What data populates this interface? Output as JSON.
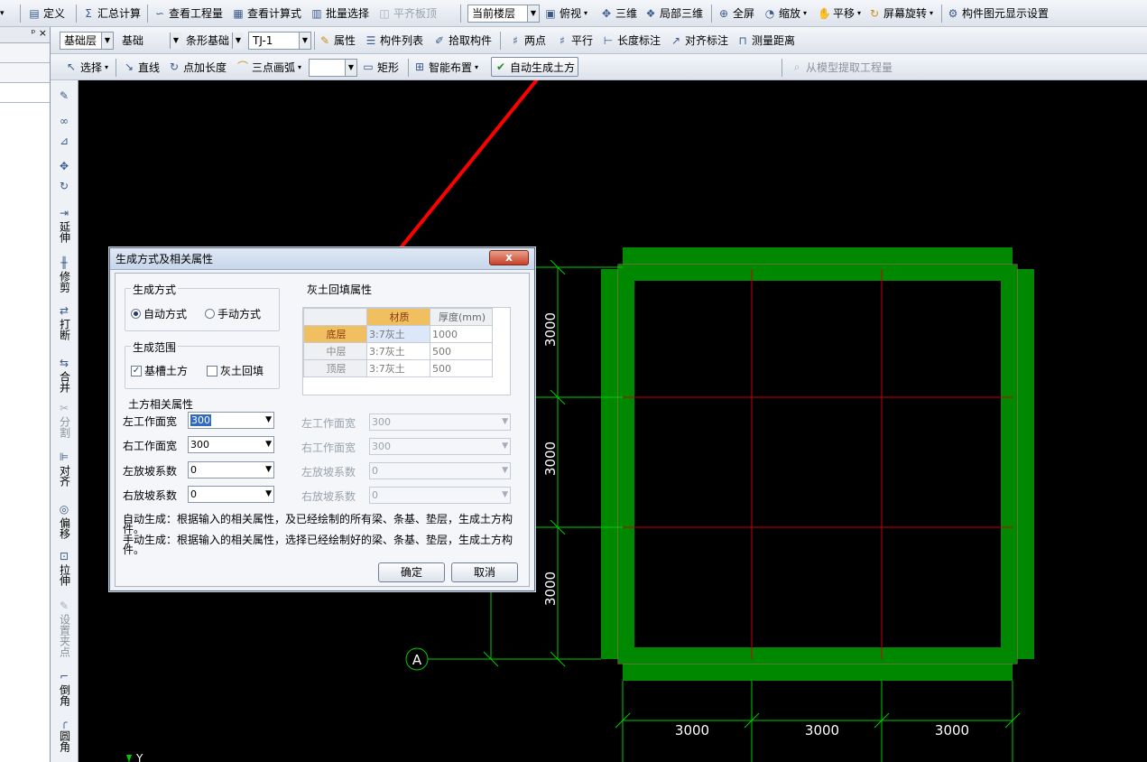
{
  "toolbar1": {
    "items": [
      "定义",
      "汇总计算",
      "查看工程量",
      "查看计算式",
      "批量选择",
      "平齐板顶"
    ],
    "floor": "当前楼层",
    "view": [
      "俯视",
      "三维",
      "局部三维",
      "全屏",
      "缩放",
      "平移",
      "屏幕旋转",
      "构件图元显示设置"
    ]
  },
  "toolbar2": {
    "layer": "基础层",
    "category": "基础",
    "type": "条形基础",
    "component": "TJ-1",
    "items": [
      "属性",
      "构件列表",
      "拾取构件",
      "两点",
      "平行",
      "长度标注",
      "对齐标注",
      "测量距离"
    ]
  },
  "toolbar3": {
    "items": [
      "选择",
      "直线",
      "点加长度",
      "三点画弧",
      "矩形",
      "智能布置",
      "自动生成土方",
      "从模型提取工程量"
    ]
  },
  "panel": {
    "pin": "ᵖ",
    "close": "×"
  },
  "vtools": [
    "延伸",
    "修剪",
    "打断",
    "合并",
    "分割",
    "对齐",
    "偏移",
    "拉伸",
    "设置夹点",
    "倒角",
    "圆角"
  ],
  "dialog": {
    "title": "生成方式及相关属性",
    "close": "x",
    "mode_group": "生成方式",
    "mode_auto": "自动方式",
    "mode_manual": "手动方式",
    "range_group": "生成范围",
    "range_pit": "基槽土方",
    "range_fill": "灰土回填",
    "earth_group": "土方相关属性",
    "fields": [
      {
        "label": "左工作面宽",
        "value": "300"
      },
      {
        "label": "右工作面宽",
        "value": "300"
      },
      {
        "label": "左放坡系数",
        "value": "0"
      },
      {
        "label": "右放坡系数",
        "value": "0"
      }
    ],
    "fill_group": "灰土回填属性",
    "fill_table": {
      "headers": [
        "材质",
        "厚度(mm)"
      ],
      "rows": [
        {
          "name": "底层",
          "material": "3:7灰土",
          "thickness": "1000"
        },
        {
          "name": "中层",
          "material": "3:7灰土",
          "thickness": "500"
        },
        {
          "name": "顶层",
          "material": "3:7灰土",
          "thickness": "500"
        }
      ]
    },
    "fill_fields": [
      {
        "label": "左工作面宽",
        "value": "300"
      },
      {
        "label": "右工作面宽",
        "value": "300"
      },
      {
        "label": "左放坡系数",
        "value": "0"
      },
      {
        "label": "右放坡系数",
        "value": "0"
      }
    ],
    "note1a": "自动生成：根据输入的相关属性，及已经绘制的所有梁、条基、垫层，生成土方构",
    "note1b": "件。",
    "note2a": "手动生成：根据输入的相关属性，选择已经绘制好的梁、条基、垫层，生成土方构",
    "note2b": "件。",
    "ok": "确定",
    "cancel": "取消"
  },
  "drawing": {
    "dims_bottom": [
      "3000",
      "3000",
      "3000"
    ],
    "dims_left": [
      "3000",
      "3000",
      "3000"
    ],
    "axis_label": "A",
    "ucs_label": "Y"
  },
  "colors": {
    "foundation": "#008800",
    "gridline": "#cc0000",
    "dim": "#00cc00",
    "arrow": "#ff0000"
  }
}
